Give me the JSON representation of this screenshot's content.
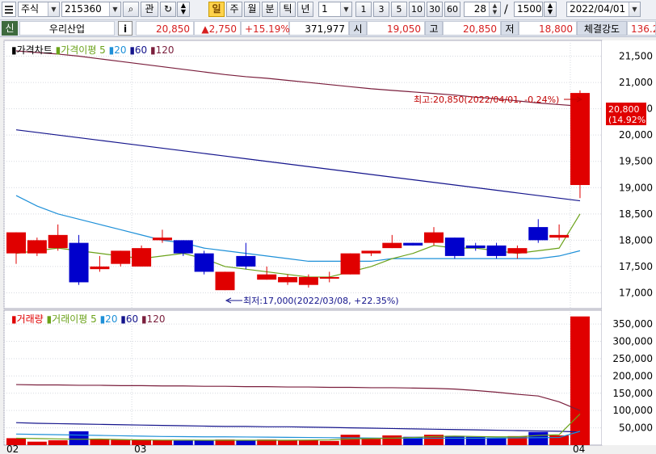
{
  "toolbar": {
    "type_value": "주식",
    "code_value": "215360",
    "btn_analysis": "관",
    "btn_day": "일",
    "btn_week": "주",
    "btn_month": "월",
    "btn_minute": "분",
    "btn_tick": "틱",
    "btn_year": "년",
    "period_value": "1",
    "quick_periods": [
      "1",
      "3",
      "5",
      "10",
      "30",
      "60"
    ],
    "count_value": "28",
    "slash": "/",
    "total_value": "1500",
    "date_value": "2022/04/01"
  },
  "infobar": {
    "sin": "신",
    "stock_name": "우리산업",
    "info_icon": "i",
    "price": "20,850",
    "change": "▲2,750",
    "change_pct": "+15.19%",
    "volume": "371,977",
    "open_label": "시",
    "open_value": "19,050",
    "high_label": "고",
    "high_value": "20,850",
    "low_label": "저",
    "low_value": "18,800",
    "strength_label": "체결강도",
    "strength_value": "136.2"
  },
  "colors": {
    "up": "#e00000",
    "down": "#0000cc",
    "ma5": "#6ba21a",
    "ma20": "#1e90d8",
    "ma60": "#14148c",
    "ma120": "#7a1e3c"
  },
  "chart_data": {
    "type": "candlestick",
    "price_legend": {
      "title": "가격차트",
      "ma_label": "가격이평",
      "periods": [
        "5",
        "20",
        "60",
        "120"
      ]
    },
    "volume_legend": {
      "title": "거래량",
      "ma_label": "거래이평",
      "periods": [
        "5",
        "20",
        "60",
        "120"
      ]
    },
    "price_axis": {
      "ylim": [
        16700,
        21800
      ],
      "ticks": [
        {
          "v": 17000,
          "label": "17,000"
        },
        {
          "v": 17500,
          "label": "17,500"
        },
        {
          "v": 18000,
          "label": "18,000"
        },
        {
          "v": 18500,
          "label": "18,500"
        },
        {
          "v": 19000,
          "label": "19,000"
        },
        {
          "v": 19500,
          "label": "19,500"
        },
        {
          "v": 20000,
          "label": "20,000"
        },
        {
          "v": 20500,
          "label": "20,500"
        },
        {
          "v": 21000,
          "label": "21,000"
        },
        {
          "v": 21500,
          "label": "21,500"
        }
      ]
    },
    "volume_axis": {
      "ylim": [
        0,
        390000
      ],
      "ticks": [
        {
          "v": 50000,
          "label": "50,000"
        },
        {
          "v": 100000,
          "label": "100,000"
        },
        {
          "v": 150000,
          "label": "150,000"
        },
        {
          "v": 200000,
          "label": "200,000"
        },
        {
          "v": 250000,
          "label": "250,000"
        },
        {
          "v": 300000,
          "label": "300,000"
        },
        {
          "v": 350000,
          "label": "350,000"
        }
      ]
    },
    "x_ticks": [
      {
        "index": 0,
        "label": "02"
      },
      {
        "index": 6,
        "label": "03"
      },
      {
        "index": 27,
        "label": "04"
      }
    ],
    "candles": [
      {
        "o": 17750,
        "h": 18150,
        "l": 17550,
        "c": 18150,
        "v": 20000
      },
      {
        "o": 17750,
        "h": 18050,
        "l": 17700,
        "c": 18000,
        "v": 10000
      },
      {
        "o": 17850,
        "h": 18300,
        "l": 17800,
        "c": 18100,
        "v": 14000
      },
      {
        "o": 17950,
        "h": 18100,
        "l": 17150,
        "c": 17200,
        "v": 40000
      },
      {
        "o": 17450,
        "h": 17700,
        "l": 17400,
        "c": 17500,
        "v": 18000
      },
      {
        "o": 17550,
        "h": 17800,
        "l": 17500,
        "c": 17800,
        "v": 15000
      },
      {
        "o": 17500,
        "h": 17900,
        "l": 17500,
        "c": 17850,
        "v": 16000
      },
      {
        "o": 18000,
        "h": 18200,
        "l": 17950,
        "c": 18050,
        "v": 15000
      },
      {
        "o": 18000,
        "h": 18000,
        "l": 17700,
        "c": 17750,
        "v": 13000
      },
      {
        "o": 17750,
        "h": 17800,
        "l": 17350,
        "c": 17400,
        "v": 15000
      },
      {
        "o": 17050,
        "h": 17400,
        "l": 17050,
        "c": 17400,
        "v": 16000
      },
      {
        "o": 17700,
        "h": 17950,
        "l": 17450,
        "c": 17500,
        "v": 14000
      },
      {
        "o": 17250,
        "h": 17500,
        "l": 17250,
        "c": 17350,
        "v": 16000
      },
      {
        "o": 17200,
        "h": 17350,
        "l": 17150,
        "c": 17300,
        "v": 13000
      },
      {
        "o": 17150,
        "h": 17350,
        "l": 17100,
        "c": 17300,
        "v": 14000
      },
      {
        "o": 17300,
        "h": 17400,
        "l": 17200,
        "c": 17300,
        "v": 12000
      },
      {
        "o": 17350,
        "h": 17750,
        "l": 17350,
        "c": 17750,
        "v": 30000
      },
      {
        "o": 17750,
        "h": 17800,
        "l": 17700,
        "c": 17800,
        "v": 18000
      },
      {
        "o": 17850,
        "h": 18100,
        "l": 17850,
        "c": 17950,
        "v": 28000
      },
      {
        "o": 17950,
        "h": 17950,
        "l": 17900,
        "c": 17900,
        "v": 24000
      },
      {
        "o": 17950,
        "h": 18250,
        "l": 17900,
        "c": 18150,
        "v": 30000
      },
      {
        "o": 18050,
        "h": 18050,
        "l": 17650,
        "c": 17700,
        "v": 27000
      },
      {
        "o": 17900,
        "h": 17950,
        "l": 17800,
        "c": 17850,
        "v": 24000
      },
      {
        "o": 17900,
        "h": 17950,
        "l": 17650,
        "c": 17700,
        "v": 22000
      },
      {
        "o": 17750,
        "h": 17900,
        "l": 17650,
        "c": 17850,
        "v": 26000
      },
      {
        "o": 18250,
        "h": 18400,
        "l": 17950,
        "c": 18000,
        "v": 38000
      },
      {
        "o": 18050,
        "h": 18300,
        "l": 18000,
        "c": 18100,
        "v": 28000
      },
      {
        "o": 19050,
        "h": 20850,
        "l": 18800,
        "c": 20800,
        "v": 371977
      }
    ],
    "ma": {
      "ma5": [
        17750,
        17800,
        17850,
        17800,
        17750,
        17700,
        17650,
        17700,
        17750,
        17650,
        17500,
        17450,
        17400,
        17350,
        17300,
        17300,
        17400,
        17500,
        17650,
        17750,
        17900,
        17850,
        17850,
        17800,
        17750,
        17800,
        17850,
        18500
      ],
      "ma20": [
        18850,
        18650,
        18500,
        18400,
        18300,
        18200,
        18100,
        18000,
        17950,
        17850,
        17800,
        17750,
        17700,
        17650,
        17600,
        17600,
        17600,
        17600,
        17650,
        17650,
        17650,
        17650,
        17650,
        17650,
        17650,
        17650,
        17700,
        17800
      ],
      "ma60": [
        20100,
        20050,
        20000,
        19950,
        19900,
        19850,
        19800,
        19750,
        19700,
        19650,
        19600,
        19550,
        19500,
        19450,
        19400,
        19350,
        19300,
        19250,
        19200,
        19150,
        19100,
        19050,
        19000,
        18950,
        18900,
        18850,
        18800,
        18750
      ],
      "ma120": [
        21600,
        21570,
        21540,
        21500,
        21450,
        21400,
        21350,
        21300,
        21250,
        21200,
        21150,
        21110,
        21080,
        21040,
        21000,
        20960,
        20920,
        20880,
        20850,
        20820,
        20790,
        20760,
        20720,
        20690,
        20650,
        20610,
        20580,
        20550
      ],
      "vma5": [
        20000,
        19000,
        18000,
        17000,
        17500,
        16000,
        15000,
        14500,
        14500,
        14000,
        14000,
        14000,
        14000,
        14000,
        14500,
        15000,
        18000,
        19000,
        20000,
        22000,
        25000,
        26000,
        25000,
        24000,
        24000,
        28000,
        30000,
        90000
      ],
      "vma20": [
        32000,
        31000,
        30000,
        29000,
        28000,
        27000,
        26000,
        25000,
        24500,
        24000,
        24000,
        23500,
        23000,
        22500,
        22000,
        21500,
        21000,
        20500,
        20000,
        20000,
        20000,
        20000,
        20000,
        20500,
        21000,
        21500,
        22000,
        40000
      ],
      "vma60": [
        65000,
        63000,
        62000,
        61000,
        60000,
        59000,
        58000,
        57000,
        56000,
        55000,
        54000,
        54000,
        53000,
        53000,
        52000,
        51000,
        50000,
        49000,
        48000,
        47000,
        46000,
        45000,
        44000,
        43000,
        42000,
        41000,
        40000,
        38000
      ],
      "vma120": [
        175000,
        174000,
        174000,
        173000,
        173000,
        172000,
        172000,
        171000,
        171000,
        170000,
        170000,
        169000,
        169000,
        168000,
        168000,
        167000,
        167000,
        166000,
        166000,
        165000,
        164000,
        162000,
        158000,
        153000,
        147000,
        142000,
        125000,
        100000
      ]
    },
    "current_label": {
      "price": "20,800",
      "pct": "(14.92%)"
    },
    "annotations": {
      "high": "최고:20,850(2022/04/01, -0.24%)",
      "low": "최저:17,000(2022/03/08, +22.35%)"
    }
  }
}
